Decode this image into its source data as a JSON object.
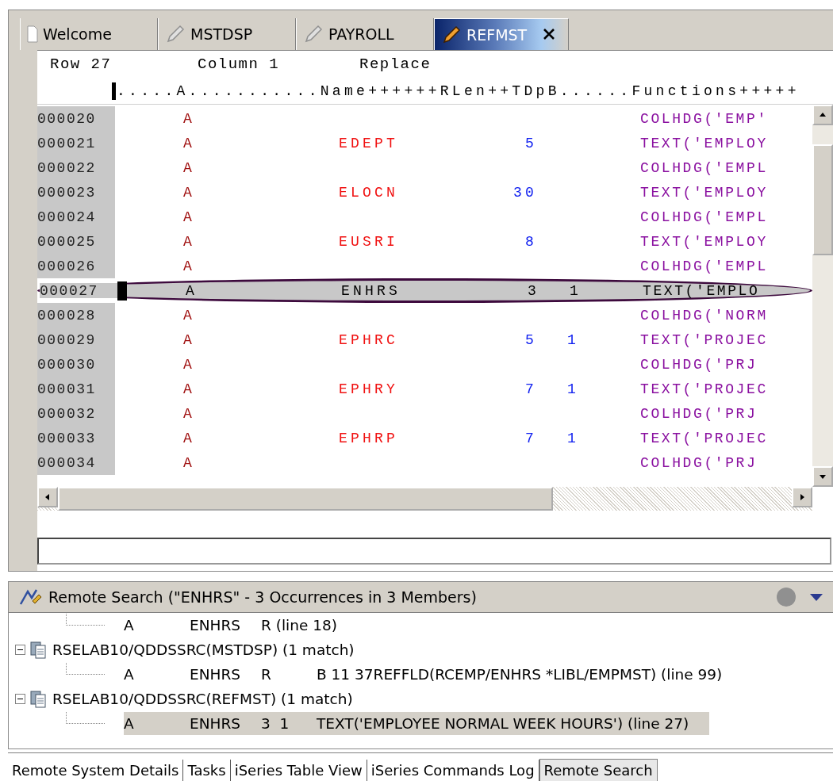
{
  "editor_tabs": [
    {
      "label": "Welcome",
      "kind": "document",
      "selected": false
    },
    {
      "label": "MSTDSP",
      "kind": "source",
      "selected": false
    },
    {
      "label": "PAYROLL",
      "kind": "source",
      "selected": false
    },
    {
      "label": "REFMST",
      "kind": "source",
      "selected": true
    }
  ],
  "status": {
    "row": "Row 27",
    "column": "Column 1",
    "mode": "Replace"
  },
  "ruler": ".....A...........Name++++++RLen++TDpB......Functions+++++",
  "lines": [
    {
      "number": "000020",
      "spec": "A",
      "func": "COLHDG('EMP'",
      "selected": false
    },
    {
      "number": "000021",
      "spec": "A",
      "name": "EDEPT",
      "length": "5",
      "func": "TEXT('EMPLOY",
      "selected": false
    },
    {
      "number": "000022",
      "spec": "A",
      "func": "COLHDG('EMPL",
      "selected": false
    },
    {
      "number": "000023",
      "spec": "A",
      "name": "ELOCN",
      "length": "30",
      "func": "TEXT('EMPLOY",
      "selected": false
    },
    {
      "number": "000024",
      "spec": "A",
      "func": "COLHDG('EMPL",
      "selected": false
    },
    {
      "number": "000025",
      "spec": "A",
      "name": "EUSRI",
      "length": "8",
      "func": "TEXT('EMPLOY",
      "selected": false
    },
    {
      "number": "000026",
      "spec": "A",
      "func": "COLHDG('EMPL",
      "selected": false
    },
    {
      "number": "000027",
      "spec": "A",
      "name": "ENHRS",
      "length": "3",
      "decimals": "1",
      "func": "TEXT('EMPLO",
      "selected": true
    },
    {
      "number": "000028",
      "spec": "A",
      "func": "COLHDG('NORM",
      "selected": false
    },
    {
      "number": "000029",
      "spec": "A",
      "name": "EPHRC",
      "length": "5",
      "decimals": "1",
      "func": "TEXT('PROJEC",
      "selected": false
    },
    {
      "number": "000030",
      "spec": "A",
      "func": "COLHDG('PRJ",
      "selected": false
    },
    {
      "number": "000031",
      "spec": "A",
      "name": "EPHRY",
      "length": "7",
      "decimals": "1",
      "func": "TEXT('PROJEC",
      "selected": false
    },
    {
      "number": "000032",
      "spec": "A",
      "func": "COLHDG('PRJ",
      "selected": false
    },
    {
      "number": "000033",
      "spec": "A",
      "name": "EPHRP",
      "length": "7",
      "decimals": "1",
      "func": "TEXT('PROJEC",
      "selected": false
    },
    {
      "number": "000034",
      "spec": "A",
      "func": "COLHDG('PRJ",
      "selected": false
    }
  ],
  "search_view": {
    "title": "Remote Search (\"ENHRS\" - 3 Occurrences in 3 Members)",
    "results": [
      {
        "kind": "match",
        "cells": [
          "A",
          "ENHRS",
          "R (line 18)"
        ],
        "selected": false
      },
      {
        "kind": "member",
        "label": "RSELAB10/QDDSSRC(MSTDSP) (1 match)",
        "expanded": true,
        "children": [
          {
            "kind": "match",
            "cells": [
              "A",
              "ENHRS",
              "R",
              "B 11 37REFFLD(RCEMP/ENHRS *LIBL/EMPMST) (line 99)"
            ],
            "selected": false
          }
        ]
      },
      {
        "kind": "member",
        "label": "RSELAB10/QDDSSRC(REFMST) (1 match)",
        "expanded": true,
        "children": [
          {
            "kind": "match",
            "cells": [
              "A",
              "ENHRS",
              "3  1",
              "TEXT('EMPLOYEE NORMAL WEEK HOURS') (line 27)"
            ],
            "selected": true
          }
        ]
      }
    ]
  },
  "view_tabs": [
    {
      "label": "Remote System Details",
      "selected": false
    },
    {
      "label": "Tasks",
      "selected": false
    },
    {
      "label": "iSeries Table View",
      "selected": false
    },
    {
      "label": "iSeries Commands Log",
      "selected": false
    },
    {
      "label": "Remote Search",
      "selected": true
    }
  ]
}
